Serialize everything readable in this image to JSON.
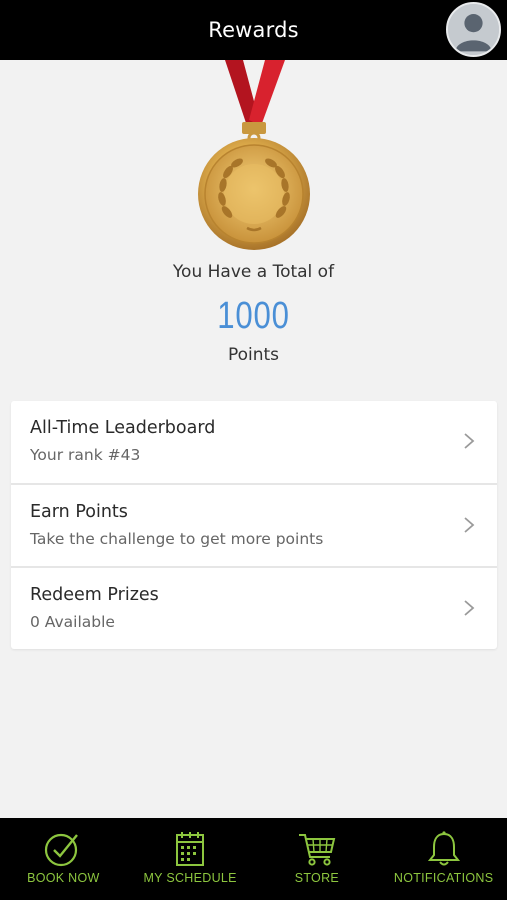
{
  "header": {
    "title": "Rewards"
  },
  "summary": {
    "label": "You Have a Total of",
    "points": "1000",
    "unit": "Points"
  },
  "menu": [
    {
      "title": "All-Time Leaderboard",
      "subtitle": "Your rank #43",
      "icon": "chevron-right-icon"
    },
    {
      "title": "Earn Points",
      "subtitle": "Take the challenge to get more points",
      "icon": "chevron-right-icon"
    },
    {
      "title": "Redeem Prizes",
      "subtitle": "0 Available",
      "icon": "chevron-right-icon"
    }
  ],
  "tabs": [
    {
      "label": "BOOK NOW",
      "icon": "check-circle-icon"
    },
    {
      "label": "MY SCHEDULE",
      "icon": "calendar-icon"
    },
    {
      "label": "STORE",
      "icon": "cart-icon"
    },
    {
      "label": "NOTIFICATIONS",
      "icon": "bell-icon"
    }
  ],
  "colors": {
    "header_bg": "#000000",
    "points_value": "#4a8fd6",
    "tab_accent": "#8dc63f",
    "ribbon": "#c8202a",
    "medal_gold": "#d9a441"
  }
}
